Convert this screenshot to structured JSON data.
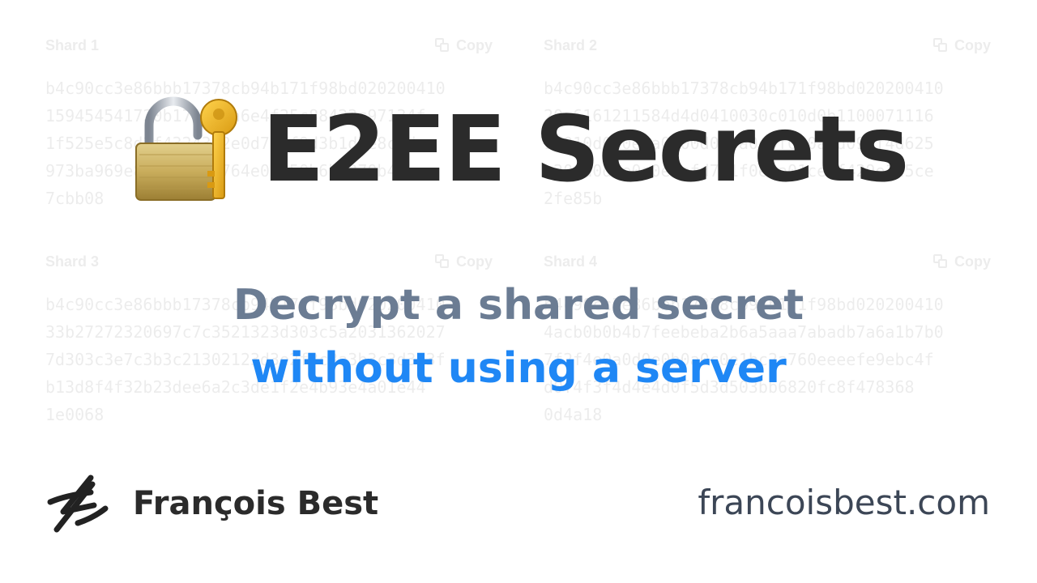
{
  "shards": [
    {
      "label": "Shard 1",
      "copy_label": "Copy",
      "lines": "b4c90cc3e86bbb17378cb94b171f98bd020200410\n159454541720b17a743a6e4f25c88422c97134f\n1f525e5c8d2f4324342e0d783f9d3b1d3e8c9d\n973ba969e8d7ac0a1b764e0f450b6bb270b4\n7cbb08"
    },
    {
      "label": "Shard 2",
      "copy_label": "Copy",
      "lines": "b4c90cc3e86bbb17378cb94b171f98bd020200410\n20a6161211584d4d0410030c010d0b1100071116\n1f010d0a0e0a0300d0b0a0e0f0e0a0d094f4d625\ne200a0d0e0a0e0afd7e1f0e0a01ce8f429e125ce\n2fe85b"
    },
    {
      "label": "Shard 3",
      "copy_label": "Copy",
      "lines": "b4c90cc3e86bbb17378cb94b171f98bd020200410\n33b27272320697c7c3521323d303c5a2031362027\n7d303c3e7c3b3c21302123d3e2f3c3a3b3c3d3e3f\nb13d8f4f32b23dee6a2c3de1f2e4b93e4a01e44\n1e0068"
    },
    {
      "label": "Shard 4",
      "copy_label": "Copy",
      "lines": "b4c90cc3e86bbb17378cb94b171f98bd020200410\n4acb0b0b4b7feebeba2b6a5aaa7abadb7a6a1b7b0\n7f2f4e0a0d0e0b0a0c0e1bc2a760eeeefe9ebc4f\nd0f4f3f4d4e4d0f5d3d503bb6820fc8f478368\n0d4a18"
    }
  ],
  "title": "E2EE Secrets",
  "tagline": {
    "line1": "Decrypt a shared secret",
    "line2": "without using a server"
  },
  "author": "François Best",
  "website": "francoisbest.com",
  "colors": {
    "title": "#2b2b2b",
    "tagline_primary": "#6b7c93",
    "tagline_accent": "#1f87f5",
    "website": "#3c4656"
  },
  "icons": {
    "title_icon": "lock-with-key-icon",
    "author_logo": "signature-logo-icon",
    "copy_icon": "copy-icon"
  }
}
